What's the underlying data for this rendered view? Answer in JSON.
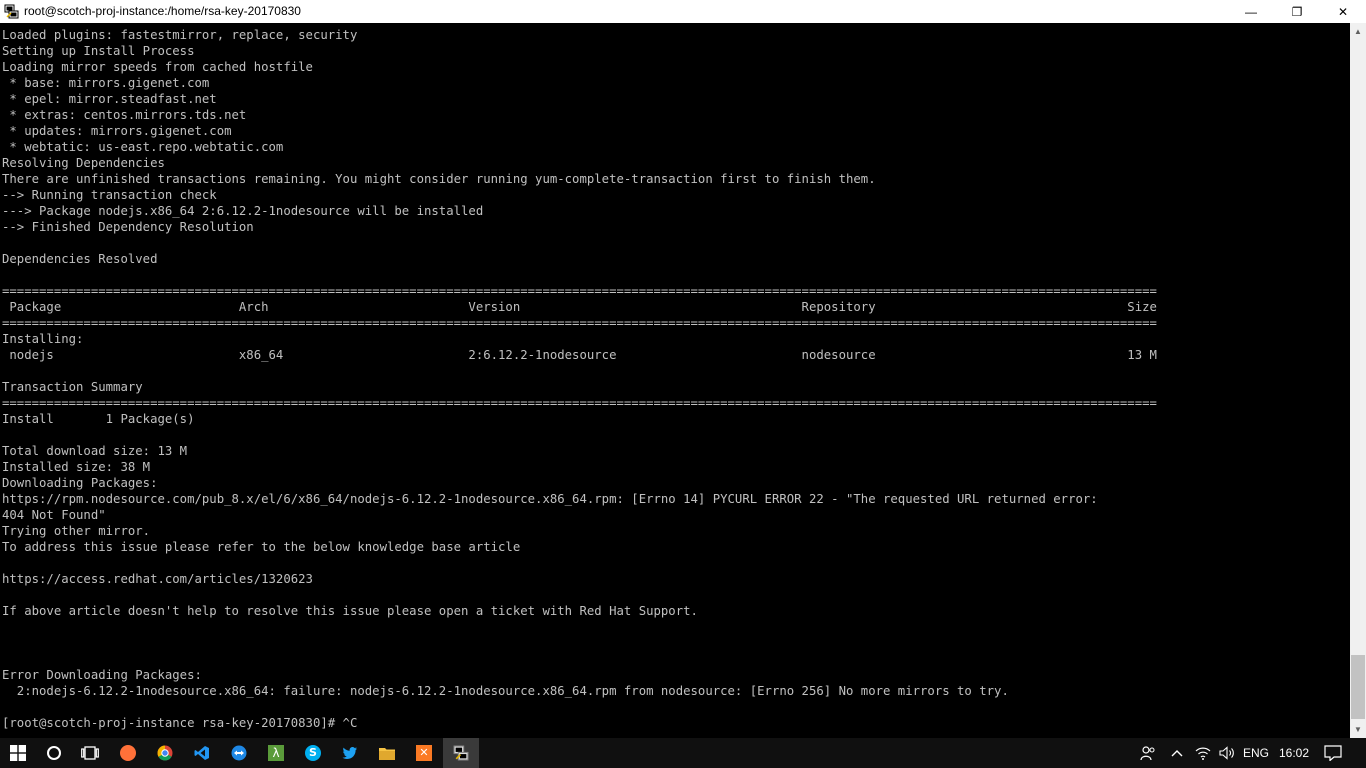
{
  "window": {
    "title": "root@scotch-proj-instance:/home/rsa-key-20170830",
    "minimize_glyph": "—",
    "maximize_glyph": "❐",
    "close_glyph": "✕"
  },
  "terminal": {
    "text": "Loaded plugins: fastestmirror, replace, security\nSetting up Install Process\nLoading mirror speeds from cached hostfile\n * base: mirrors.gigenet.com\n * epel: mirror.steadfast.net\n * extras: centos.mirrors.tds.net\n * updates: mirrors.gigenet.com\n * webtatic: us-east.repo.webtatic.com\nResolving Dependencies\nThere are unfinished transactions remaining. You might consider running yum-complete-transaction first to finish them.\n--> Running transaction check\n---> Package nodejs.x86_64 2:6.12.2-1nodesource will be installed\n--> Finished Dependency Resolution\n\nDependencies Resolved\n\n============================================================================================================================================================\n Package                        Arch                           Version                                      Repository                                  Size\n============================================================================================================================================================\nInstalling:\n nodejs                         x86_64                         2:6.12.2-1nodesource                         nodesource                                  13 M\n\nTransaction Summary\n============================================================================================================================================================\nInstall       1 Package(s)\n\nTotal download size: 13 M\nInstalled size: 38 M\nDownloading Packages:\nhttps://rpm.nodesource.com/pub_8.x/el/6/x86_64/nodejs-6.12.2-1nodesource.x86_64.rpm: [Errno 14] PYCURL ERROR 22 - \"The requested URL returned error:\n404 Not Found\"\nTrying other mirror.\nTo address this issue please refer to the below knowledge base article\n\nhttps://access.redhat.com/articles/1320623\n\nIf above article doesn't help to resolve this issue please open a ticket with Red Hat Support.\n\n\n\nError Downloading Packages:\n  2:nodejs-6.12.2-1nodesource.x86_64: failure: nodejs-6.12.2-1nodesource.x86_64.rpm from nodesource: [Errno 256] No more mirrors to try.\n\n[root@scotch-proj-instance rsa-key-20170830]# ^C"
  },
  "scrollbar": {
    "up_glyph": "▲",
    "down_glyph": "▼"
  },
  "taskbar": {
    "language": "ENG",
    "time": "16:02",
    "apps": [
      {
        "name": "firefox",
        "color": "#ff7139"
      },
      {
        "name": "chrome",
        "color": "#4caf50"
      },
      {
        "name": "vscode",
        "color": "#2196f3"
      },
      {
        "name": "teamviewer",
        "color": "#1e88e5"
      },
      {
        "name": "lambda",
        "color": "#5a9b3a"
      },
      {
        "name": "skype",
        "color": "#00aff0"
      },
      {
        "name": "twitter",
        "color": "#1da1f2"
      },
      {
        "name": "file-explorer",
        "color": "#f6c344"
      },
      {
        "name": "xampp",
        "color": "#fb7a24"
      },
      {
        "name": "putty",
        "color": "#c8c8c8"
      }
    ]
  }
}
